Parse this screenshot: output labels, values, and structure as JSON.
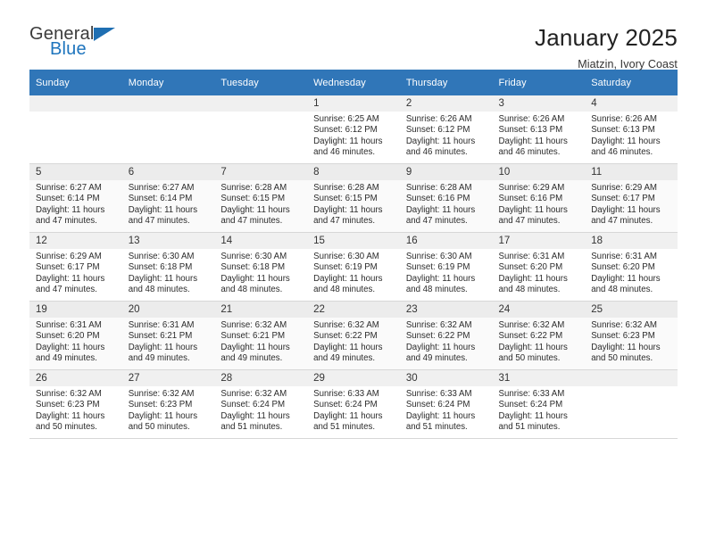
{
  "brand": {
    "name_part1": "General",
    "name_part2": "Blue",
    "accent_color": "#1d74bd",
    "header_color": "#3076b8"
  },
  "header": {
    "title": "January 2025",
    "subtitle": "Miatzin, Ivory Coast"
  },
  "calendar": {
    "weekday_headers": [
      "Sunday",
      "Monday",
      "Tuesday",
      "Wednesday",
      "Thursday",
      "Friday",
      "Saturday"
    ],
    "labels": {
      "sunrise_prefix": "Sunrise:",
      "sunset_prefix": "Sunset:",
      "daylight_prefix": "Daylight:"
    },
    "weeks": [
      [
        {
          "day": "",
          "empty": true
        },
        {
          "day": "",
          "empty": true
        },
        {
          "day": "",
          "empty": true
        },
        {
          "day": "1",
          "sunrise": "Sunrise: 6:25 AM",
          "sunset": "Sunset: 6:12 PM",
          "daylight_line1": "Daylight: 11 hours",
          "daylight_line2": "and 46 minutes."
        },
        {
          "day": "2",
          "sunrise": "Sunrise: 6:26 AM",
          "sunset": "Sunset: 6:12 PM",
          "daylight_line1": "Daylight: 11 hours",
          "daylight_line2": "and 46 minutes."
        },
        {
          "day": "3",
          "sunrise": "Sunrise: 6:26 AM",
          "sunset": "Sunset: 6:13 PM",
          "daylight_line1": "Daylight: 11 hours",
          "daylight_line2": "and 46 minutes."
        },
        {
          "day": "4",
          "sunrise": "Sunrise: 6:26 AM",
          "sunset": "Sunset: 6:13 PM",
          "daylight_line1": "Daylight: 11 hours",
          "daylight_line2": "and 46 minutes."
        }
      ],
      [
        {
          "day": "5",
          "sunrise": "Sunrise: 6:27 AM",
          "sunset": "Sunset: 6:14 PM",
          "daylight_line1": "Daylight: 11 hours",
          "daylight_line2": "and 47 minutes."
        },
        {
          "day": "6",
          "sunrise": "Sunrise: 6:27 AM",
          "sunset": "Sunset: 6:14 PM",
          "daylight_line1": "Daylight: 11 hours",
          "daylight_line2": "and 47 minutes."
        },
        {
          "day": "7",
          "sunrise": "Sunrise: 6:28 AM",
          "sunset": "Sunset: 6:15 PM",
          "daylight_line1": "Daylight: 11 hours",
          "daylight_line2": "and 47 minutes."
        },
        {
          "day": "8",
          "sunrise": "Sunrise: 6:28 AM",
          "sunset": "Sunset: 6:15 PM",
          "daylight_line1": "Daylight: 11 hours",
          "daylight_line2": "and 47 minutes."
        },
        {
          "day": "9",
          "sunrise": "Sunrise: 6:28 AM",
          "sunset": "Sunset: 6:16 PM",
          "daylight_line1": "Daylight: 11 hours",
          "daylight_line2": "and 47 minutes."
        },
        {
          "day": "10",
          "sunrise": "Sunrise: 6:29 AM",
          "sunset": "Sunset: 6:16 PM",
          "daylight_line1": "Daylight: 11 hours",
          "daylight_line2": "and 47 minutes."
        },
        {
          "day": "11",
          "sunrise": "Sunrise: 6:29 AM",
          "sunset": "Sunset: 6:17 PM",
          "daylight_line1": "Daylight: 11 hours",
          "daylight_line2": "and 47 minutes."
        }
      ],
      [
        {
          "day": "12",
          "sunrise": "Sunrise: 6:29 AM",
          "sunset": "Sunset: 6:17 PM",
          "daylight_line1": "Daylight: 11 hours",
          "daylight_line2": "and 47 minutes."
        },
        {
          "day": "13",
          "sunrise": "Sunrise: 6:30 AM",
          "sunset": "Sunset: 6:18 PM",
          "daylight_line1": "Daylight: 11 hours",
          "daylight_line2": "and 48 minutes."
        },
        {
          "day": "14",
          "sunrise": "Sunrise: 6:30 AM",
          "sunset": "Sunset: 6:18 PM",
          "daylight_line1": "Daylight: 11 hours",
          "daylight_line2": "and 48 minutes."
        },
        {
          "day": "15",
          "sunrise": "Sunrise: 6:30 AM",
          "sunset": "Sunset: 6:19 PM",
          "daylight_line1": "Daylight: 11 hours",
          "daylight_line2": "and 48 minutes."
        },
        {
          "day": "16",
          "sunrise": "Sunrise: 6:30 AM",
          "sunset": "Sunset: 6:19 PM",
          "daylight_line1": "Daylight: 11 hours",
          "daylight_line2": "and 48 minutes."
        },
        {
          "day": "17",
          "sunrise": "Sunrise: 6:31 AM",
          "sunset": "Sunset: 6:20 PM",
          "daylight_line1": "Daylight: 11 hours",
          "daylight_line2": "and 48 minutes."
        },
        {
          "day": "18",
          "sunrise": "Sunrise: 6:31 AM",
          "sunset": "Sunset: 6:20 PM",
          "daylight_line1": "Daylight: 11 hours",
          "daylight_line2": "and 48 minutes."
        }
      ],
      [
        {
          "day": "19",
          "sunrise": "Sunrise: 6:31 AM",
          "sunset": "Sunset: 6:20 PM",
          "daylight_line1": "Daylight: 11 hours",
          "daylight_line2": "and 49 minutes."
        },
        {
          "day": "20",
          "sunrise": "Sunrise: 6:31 AM",
          "sunset": "Sunset: 6:21 PM",
          "daylight_line1": "Daylight: 11 hours",
          "daylight_line2": "and 49 minutes."
        },
        {
          "day": "21",
          "sunrise": "Sunrise: 6:32 AM",
          "sunset": "Sunset: 6:21 PM",
          "daylight_line1": "Daylight: 11 hours",
          "daylight_line2": "and 49 minutes."
        },
        {
          "day": "22",
          "sunrise": "Sunrise: 6:32 AM",
          "sunset": "Sunset: 6:22 PM",
          "daylight_line1": "Daylight: 11 hours",
          "daylight_line2": "and 49 minutes."
        },
        {
          "day": "23",
          "sunrise": "Sunrise: 6:32 AM",
          "sunset": "Sunset: 6:22 PM",
          "daylight_line1": "Daylight: 11 hours",
          "daylight_line2": "and 49 minutes."
        },
        {
          "day": "24",
          "sunrise": "Sunrise: 6:32 AM",
          "sunset": "Sunset: 6:22 PM",
          "daylight_line1": "Daylight: 11 hours",
          "daylight_line2": "and 50 minutes."
        },
        {
          "day": "25",
          "sunrise": "Sunrise: 6:32 AM",
          "sunset": "Sunset: 6:23 PM",
          "daylight_line1": "Daylight: 11 hours",
          "daylight_line2": "and 50 minutes."
        }
      ],
      [
        {
          "day": "26",
          "sunrise": "Sunrise: 6:32 AM",
          "sunset": "Sunset: 6:23 PM",
          "daylight_line1": "Daylight: 11 hours",
          "daylight_line2": "and 50 minutes."
        },
        {
          "day": "27",
          "sunrise": "Sunrise: 6:32 AM",
          "sunset": "Sunset: 6:23 PM",
          "daylight_line1": "Daylight: 11 hours",
          "daylight_line2": "and 50 minutes."
        },
        {
          "day": "28",
          "sunrise": "Sunrise: 6:32 AM",
          "sunset": "Sunset: 6:24 PM",
          "daylight_line1": "Daylight: 11 hours",
          "daylight_line2": "and 51 minutes."
        },
        {
          "day": "29",
          "sunrise": "Sunrise: 6:33 AM",
          "sunset": "Sunset: 6:24 PM",
          "daylight_line1": "Daylight: 11 hours",
          "daylight_line2": "and 51 minutes."
        },
        {
          "day": "30",
          "sunrise": "Sunrise: 6:33 AM",
          "sunset": "Sunset: 6:24 PM",
          "daylight_line1": "Daylight: 11 hours",
          "daylight_line2": "and 51 minutes."
        },
        {
          "day": "31",
          "sunrise": "Sunrise: 6:33 AM",
          "sunset": "Sunset: 6:24 PM",
          "daylight_line1": "Daylight: 11 hours",
          "daylight_line2": "and 51 minutes."
        },
        {
          "day": "",
          "empty": true
        }
      ]
    ]
  }
}
